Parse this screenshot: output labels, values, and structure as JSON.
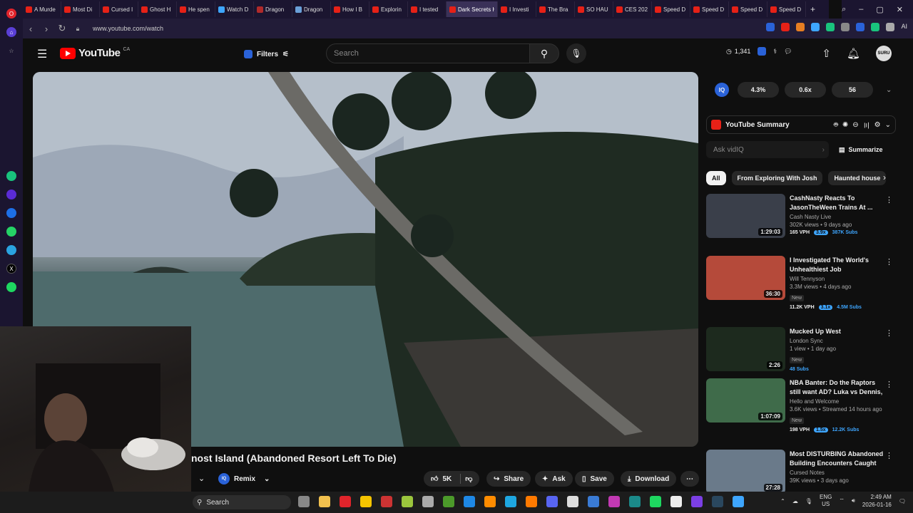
{
  "browser": {
    "tabs": [
      {
        "label": "A Murde",
        "color": "#e62117"
      },
      {
        "label": "Most Di",
        "color": "#e62117"
      },
      {
        "label": "Cursed I",
        "color": "#e62117"
      },
      {
        "label": "Ghost H",
        "color": "#e62117"
      },
      {
        "label": "He spen",
        "color": "#e62117"
      },
      {
        "label": "Watch D",
        "color": "#3ea6ff"
      },
      {
        "label": "Dragon",
        "color": "#b02a2a"
      },
      {
        "label": "Dragon",
        "color": "#6aa0d8"
      },
      {
        "label": "How I B",
        "color": "#e62117"
      },
      {
        "label": "Explorin",
        "color": "#e62117"
      },
      {
        "label": "I tested",
        "color": "#e62117"
      },
      {
        "label": "Dark Secrets H",
        "color": "#e62117",
        "active": true
      },
      {
        "label": "I Investi",
        "color": "#e62117"
      },
      {
        "label": "The Bra",
        "color": "#e62117"
      },
      {
        "label": "SO HAU",
        "color": "#e62117"
      },
      {
        "label": "CES 202",
        "color": "#e62117"
      },
      {
        "label": "Speed D",
        "color": "#e62117"
      },
      {
        "label": "Speed D",
        "color": "#e62117"
      },
      {
        "label": "Speed D",
        "color": "#e62117"
      },
      {
        "label": "Speed D",
        "color": "#e62117"
      }
    ],
    "url": "www.youtube.com/watch",
    "ai_label": "AI"
  },
  "youtube": {
    "logo_text": "YouTube",
    "country_code": "CA",
    "filters_label": "Filters",
    "search_placeholder": "Search",
    "views_count": "1,341"
  },
  "video": {
    "title": "Ghost Island (Abandoned Resort Left To Die)",
    "visible_title": "nost Island (Abandoned Resort Left To Die)",
    "actions": {
      "remix": "Remix",
      "likes": "5K",
      "share": "Share",
      "ask": "Ask",
      "save": "Save",
      "download": "Download"
    }
  },
  "vidiq": {
    "label": "IQ",
    "stat1": "4.3%",
    "stat2": "0.6x",
    "stat3": "56"
  },
  "summary": {
    "title": "YouTube Summary",
    "ask_placeholder": "Ask vidIQ",
    "summarize_label": "Summarize"
  },
  "chips": [
    "All",
    "From Exploring With Josh",
    "Haunted house"
  ],
  "recommendations": [
    {
      "title": "CashNasty Reacts To JasonTheWeen Trains At ...",
      "channel": "Cash Nasty Live",
      "views": "302K views • 9 days ago",
      "duration": "1:29:03",
      "vph": "165 VPH",
      "mult": "3.9x",
      "subs": "387K Subs",
      "is_new": false,
      "thumb_color": "#3a3f4a"
    },
    {
      "title": "I Investigated The World's Unhealthiest Job",
      "channel": "Will Tennyson",
      "views": "3.3M views • 4 days ago",
      "duration": "36:30",
      "new_label": "New",
      "vph": "11.2K VPH",
      "mult": "3.1x",
      "subs": "4.5M Subs",
      "is_new": true,
      "thumb_color": "#b54a3a"
    },
    {
      "title": "Mucked Up West",
      "channel": "London Sync",
      "views": "1 view • 1 day ago",
      "duration": "2:26",
      "new_label": "New",
      "vph": "",
      "mult": "",
      "subs": "48 Subs",
      "is_new": true,
      "thumb_color": "#1d2a1e"
    },
    {
      "title": "NBA Banter: Do the Raptors still want AD? Luka vs Dennis, Spu...",
      "channel": "Hello and Welcome",
      "views": "3.6K views • Streamed 14 hours ago",
      "duration": "1:07:09",
      "new_label": "New",
      "vph": "198 VPH",
      "mult": "1.5x",
      "subs": "12.2K Subs",
      "is_new": true,
      "thumb_color": "#3f6b4a"
    },
    {
      "title": "Most DISTURBING Abandoned Building Encounters Caught o...",
      "channel": "Cursed Notes",
      "views": "39K views • 3 days ago",
      "duration": "27:28",
      "vph": "",
      "mult": "",
      "subs": "",
      "is_new": false,
      "thumb_color": "#6a7a8a"
    }
  ],
  "taskbar": {
    "search_label": "Search",
    "lang_top": "ENG",
    "lang_bottom": "US",
    "time": "2:49 AM",
    "date": "2026-01-16"
  }
}
